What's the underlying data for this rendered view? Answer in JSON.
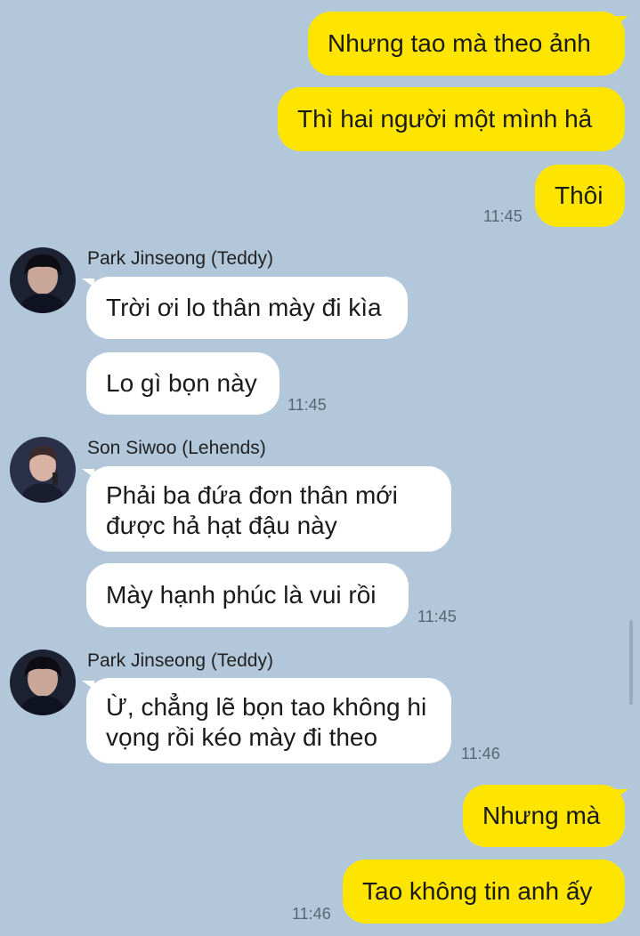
{
  "messages": {
    "m1": "Nhưng tao mà theo ảnh",
    "m2": "Thì hai người một mình hả",
    "m3": "Thôi",
    "m3_time": "11:45",
    "p1_name": "Park Jinseong (Teddy)",
    "p1_msg1": "Trời ơi lo thân mày đi kìa",
    "p1_msg2": "Lo gì bọn này",
    "p1_time": "11:45",
    "s1_name": "Son Siwoo (Lehends)",
    "s1_msg1": "Phải ba đứa đơn thân mới được hả hạt đậu này",
    "s1_msg2": "Mày hạnh phúc là vui rồi",
    "s1_time": "11:45",
    "p2_name": "Park Jinseong (Teddy)",
    "p2_msg1": "Ừ, chẳng lẽ bọn tao không hi vọng rồi kéo mày đi theo",
    "p2_time": "11:46",
    "m4": "Nhưng mà",
    "m5": "Tao không tin anh ấy",
    "m5_time": "11:46"
  },
  "colors": {
    "background": "#b2c7da",
    "my_bubble": "#fee500",
    "their_bubble": "#ffffff"
  }
}
